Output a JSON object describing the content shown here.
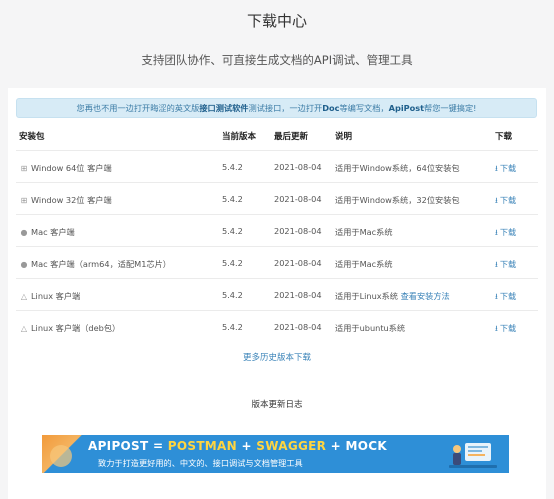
{
  "header": {
    "title": "下载中心",
    "subtitle": "支持团队协作、可直接生成文档的API调试、管理工具"
  },
  "notice": {
    "part1": "您再也不用一边打开晦涩的英文版",
    "bold1": "接口测试软件",
    "part2": "测试接口，一边打开",
    "bold2": "Doc",
    "part3": "等编写文档，",
    "bold3": "ApiPost",
    "part4": "帮您一键搞定!"
  },
  "table": {
    "headers": {
      "package": "安装包",
      "version": "当前版本",
      "updated": "最后更新",
      "description": "说明",
      "download": "下载"
    },
    "rows": [
      {
        "icon": "windows-icon",
        "icon_glyph": "⊞",
        "package": "Window 64位 客户端",
        "version": "5.4.2",
        "date": "2021-08-04",
        "desc": "适用于Window系统，64位安装包",
        "desc_link": "",
        "download": "下载"
      },
      {
        "icon": "windows-icon",
        "icon_glyph": "⊞",
        "package": "Window 32位 客户端",
        "version": "5.4.2",
        "date": "2021-08-04",
        "desc": "适用于Window系统，32位安装包",
        "desc_link": "",
        "download": "下载"
      },
      {
        "icon": "apple-icon",
        "icon_glyph": "●",
        "package": "Mac 客户端",
        "version": "5.4.2",
        "date": "2021-08-04",
        "desc": "适用于Mac系统",
        "desc_link": "",
        "download": "下载"
      },
      {
        "icon": "apple-icon",
        "icon_glyph": "●",
        "package": "Mac 客户端（arm64，适配M1芯片）",
        "version": "5.4.2",
        "date": "2021-08-04",
        "desc": "适用于Mac系统",
        "desc_link": "",
        "download": "下载"
      },
      {
        "icon": "linux-icon",
        "icon_glyph": "△",
        "package": "Linux 客户端",
        "version": "5.4.2",
        "date": "2021-08-04",
        "desc": "适用于Linux系统",
        "desc_link": "查看安装方法",
        "download": "下载"
      },
      {
        "icon": "linux-icon",
        "icon_glyph": "△",
        "package": "Linux 客户端（deb包）",
        "version": "5.4.2",
        "date": "2021-08-04",
        "desc": "适用于ubuntu系统",
        "desc_link": "",
        "download": "下载"
      }
    ]
  },
  "more_link": "更多历史版本下载",
  "changelog": "版本更新日志",
  "banner": {
    "t1": "APIPOST = ",
    "t2": "POSTMAN",
    "t3": " + ",
    "t4": "SWAGGER",
    "t5": " + MOCK",
    "subtitle": "致力于打造更好用的、中文的、接口调试与文档管理工具"
  },
  "colors": {
    "accent": "#3a83b8",
    "notice_bg": "#d7ebf6",
    "banner_bg": "#2e8fd7",
    "banner_highlight": "#ffd541"
  }
}
